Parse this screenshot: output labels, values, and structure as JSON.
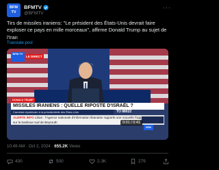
{
  "account": {
    "name": "BFMTV",
    "handle": "@BFMTV",
    "avatar_text": "BFM TV",
    "verified_color": "#1d9bf0"
  },
  "tweet": {
    "text": "Tirs de missiles iraniens: \"Le président des États-Unis devrait faire exploser ce pays en mille morceaux\", affirme Donald Trump au sujet de l'Iran",
    "translate_label": "Translate post"
  },
  "video": {
    "logo_text": "BFM TV",
    "direct_label": "LE DIRECT",
    "live_tag": "DONALD TRUMP",
    "headline": "MISSILES IRANIENS : QUELLE RIPOSTE D'ISRAËL ?",
    "subline": "Candidat républicain à la présidentielle des États-Unis",
    "sms": "TO 88022",
    "alert_label": "ALERTE INFO",
    "alert_text": "Liban : l'Agence nationale d'information libanaise rapporte une nouvelle frappe israélienne sur la banlieue sud de Beyrouth",
    "timer": "0:01 / 0:41",
    "mini_logo": "BFM"
  },
  "meta": {
    "time": "10:49 AM",
    "separator": "·",
    "date": "Oct 2, 2024",
    "views_count": "655.2K",
    "views_label": "Views"
  },
  "actions": {
    "replies": "430",
    "reposts": "500",
    "likes": "2.3K",
    "bookmarks": "279"
  }
}
